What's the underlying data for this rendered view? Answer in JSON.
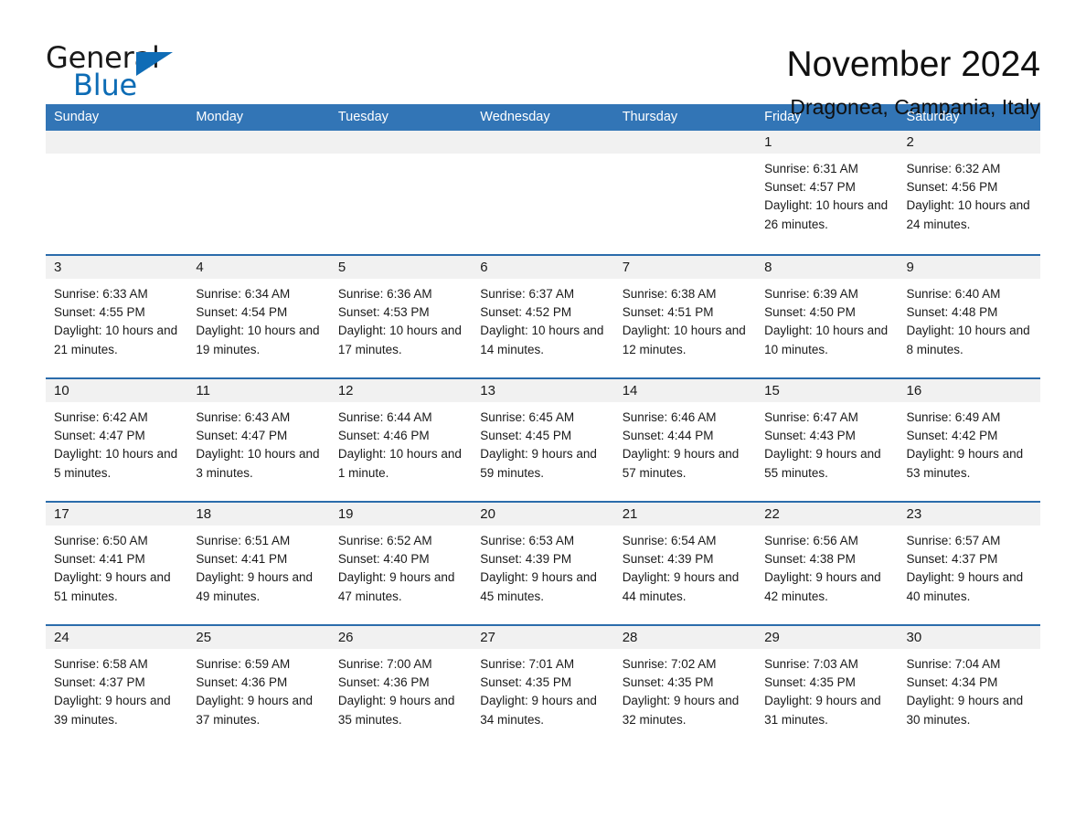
{
  "brand": {
    "name_part1": "General",
    "name_part2": "Blue",
    "flag_icon": "triangle-flag-icon",
    "accent_color": "#0f6cb6"
  },
  "header": {
    "month_title": "November 2024",
    "location": "Dragonea, Campania, Italy"
  },
  "calendar": {
    "header_bg": "#3275b6",
    "row_divider": "#2b6cab",
    "day_band_bg": "#f1f1f1",
    "weekdays": [
      "Sunday",
      "Monday",
      "Tuesday",
      "Wednesday",
      "Thursday",
      "Friday",
      "Saturday"
    ],
    "weeks": [
      [
        {
          "day": "",
          "empty": true
        },
        {
          "day": "",
          "empty": true
        },
        {
          "day": "",
          "empty": true
        },
        {
          "day": "",
          "empty": true
        },
        {
          "day": "",
          "empty": true
        },
        {
          "day": "1",
          "sunrise": "Sunrise: 6:31 AM",
          "sunset": "Sunset: 4:57 PM",
          "daylight": "Daylight: 10 hours and 26 minutes."
        },
        {
          "day": "2",
          "sunrise": "Sunrise: 6:32 AM",
          "sunset": "Sunset: 4:56 PM",
          "daylight": "Daylight: 10 hours and 24 minutes."
        }
      ],
      [
        {
          "day": "3",
          "sunrise": "Sunrise: 6:33 AM",
          "sunset": "Sunset: 4:55 PM",
          "daylight": "Daylight: 10 hours and 21 minutes."
        },
        {
          "day": "4",
          "sunrise": "Sunrise: 6:34 AM",
          "sunset": "Sunset: 4:54 PM",
          "daylight": "Daylight: 10 hours and 19 minutes."
        },
        {
          "day": "5",
          "sunrise": "Sunrise: 6:36 AM",
          "sunset": "Sunset: 4:53 PM",
          "daylight": "Daylight: 10 hours and 17 minutes."
        },
        {
          "day": "6",
          "sunrise": "Sunrise: 6:37 AM",
          "sunset": "Sunset: 4:52 PM",
          "daylight": "Daylight: 10 hours and 14 minutes."
        },
        {
          "day": "7",
          "sunrise": "Sunrise: 6:38 AM",
          "sunset": "Sunset: 4:51 PM",
          "daylight": "Daylight: 10 hours and 12 minutes."
        },
        {
          "day": "8",
          "sunrise": "Sunrise: 6:39 AM",
          "sunset": "Sunset: 4:50 PM",
          "daylight": "Daylight: 10 hours and 10 minutes."
        },
        {
          "day": "9",
          "sunrise": "Sunrise: 6:40 AM",
          "sunset": "Sunset: 4:48 PM",
          "daylight": "Daylight: 10 hours and 8 minutes."
        }
      ],
      [
        {
          "day": "10",
          "sunrise": "Sunrise: 6:42 AM",
          "sunset": "Sunset: 4:47 PM",
          "daylight": "Daylight: 10 hours and 5 minutes."
        },
        {
          "day": "11",
          "sunrise": "Sunrise: 6:43 AM",
          "sunset": "Sunset: 4:47 PM",
          "daylight": "Daylight: 10 hours and 3 minutes."
        },
        {
          "day": "12",
          "sunrise": "Sunrise: 6:44 AM",
          "sunset": "Sunset: 4:46 PM",
          "daylight": "Daylight: 10 hours and 1 minute."
        },
        {
          "day": "13",
          "sunrise": "Sunrise: 6:45 AM",
          "sunset": "Sunset: 4:45 PM",
          "daylight": "Daylight: 9 hours and 59 minutes."
        },
        {
          "day": "14",
          "sunrise": "Sunrise: 6:46 AM",
          "sunset": "Sunset: 4:44 PM",
          "daylight": "Daylight: 9 hours and 57 minutes."
        },
        {
          "day": "15",
          "sunrise": "Sunrise: 6:47 AM",
          "sunset": "Sunset: 4:43 PM",
          "daylight": "Daylight: 9 hours and 55 minutes."
        },
        {
          "day": "16",
          "sunrise": "Sunrise: 6:49 AM",
          "sunset": "Sunset: 4:42 PM",
          "daylight": "Daylight: 9 hours and 53 minutes."
        }
      ],
      [
        {
          "day": "17",
          "sunrise": "Sunrise: 6:50 AM",
          "sunset": "Sunset: 4:41 PM",
          "daylight": "Daylight: 9 hours and 51 minutes."
        },
        {
          "day": "18",
          "sunrise": "Sunrise: 6:51 AM",
          "sunset": "Sunset: 4:41 PM",
          "daylight": "Daylight: 9 hours and 49 minutes."
        },
        {
          "day": "19",
          "sunrise": "Sunrise: 6:52 AM",
          "sunset": "Sunset: 4:40 PM",
          "daylight": "Daylight: 9 hours and 47 minutes."
        },
        {
          "day": "20",
          "sunrise": "Sunrise: 6:53 AM",
          "sunset": "Sunset: 4:39 PM",
          "daylight": "Daylight: 9 hours and 45 minutes."
        },
        {
          "day": "21",
          "sunrise": "Sunrise: 6:54 AM",
          "sunset": "Sunset: 4:39 PM",
          "daylight": "Daylight: 9 hours and 44 minutes."
        },
        {
          "day": "22",
          "sunrise": "Sunrise: 6:56 AM",
          "sunset": "Sunset: 4:38 PM",
          "daylight": "Daylight: 9 hours and 42 minutes."
        },
        {
          "day": "23",
          "sunrise": "Sunrise: 6:57 AM",
          "sunset": "Sunset: 4:37 PM",
          "daylight": "Daylight: 9 hours and 40 minutes."
        }
      ],
      [
        {
          "day": "24",
          "sunrise": "Sunrise: 6:58 AM",
          "sunset": "Sunset: 4:37 PM",
          "daylight": "Daylight: 9 hours and 39 minutes."
        },
        {
          "day": "25",
          "sunrise": "Sunrise: 6:59 AM",
          "sunset": "Sunset: 4:36 PM",
          "daylight": "Daylight: 9 hours and 37 minutes."
        },
        {
          "day": "26",
          "sunrise": "Sunrise: 7:00 AM",
          "sunset": "Sunset: 4:36 PM",
          "daylight": "Daylight: 9 hours and 35 minutes."
        },
        {
          "day": "27",
          "sunrise": "Sunrise: 7:01 AM",
          "sunset": "Sunset: 4:35 PM",
          "daylight": "Daylight: 9 hours and 34 minutes."
        },
        {
          "day": "28",
          "sunrise": "Sunrise: 7:02 AM",
          "sunset": "Sunset: 4:35 PM",
          "daylight": "Daylight: 9 hours and 32 minutes."
        },
        {
          "day": "29",
          "sunrise": "Sunrise: 7:03 AM",
          "sunset": "Sunset: 4:35 PM",
          "daylight": "Daylight: 9 hours and 31 minutes."
        },
        {
          "day": "30",
          "sunrise": "Sunrise: 7:04 AM",
          "sunset": "Sunset: 4:34 PM",
          "daylight": "Daylight: 9 hours and 30 minutes."
        }
      ]
    ]
  }
}
